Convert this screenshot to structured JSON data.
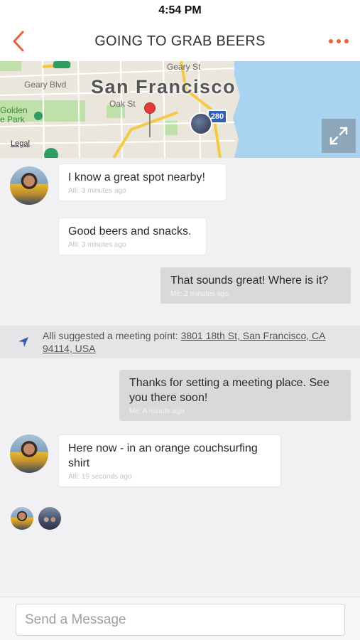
{
  "status_bar": {
    "time": "4:54 PM"
  },
  "header": {
    "title": "GOING TO GRAB BEERS",
    "back_icon": "chevron-left-icon",
    "more_icon": "more-dots-icon",
    "accent_color": "#e8623a"
  },
  "map": {
    "city": "San Francisco",
    "streets": {
      "geary_st": "Geary St",
      "geary_blvd": "Geary Blvd",
      "oak_st": "Oak St"
    },
    "park": "Golden\ne Park",
    "highway": "280",
    "legal": "Legal",
    "expand_icon": "expand-icon"
  },
  "messages": [
    {
      "text": "I know a great spot nearby!",
      "meta": "Alli: 3 minutes ago",
      "direction": "in"
    },
    {
      "text": "Good beers and snacks.",
      "meta": "Alli: 3 minutes ago",
      "direction": "in"
    },
    {
      "text": "That sounds great! Where is it?",
      "meta": "Me: 2 minutes ago",
      "direction": "out"
    },
    {
      "text": "Thanks for setting a meeting place. See you there soon!",
      "meta": "Me: A minute ago",
      "direction": "out"
    },
    {
      "text": "Here now - in an orange couchsurfing shirt",
      "meta": "Alli: 19 seconds ago",
      "direction": "in"
    }
  ],
  "system_message": {
    "prefix": "Alli suggested a meeting point: ",
    "address": "3801 18th St, San Francisco, CA 94114, USA",
    "icon": "location-arrow-icon"
  },
  "composer": {
    "placeholder": "Send a Message"
  }
}
